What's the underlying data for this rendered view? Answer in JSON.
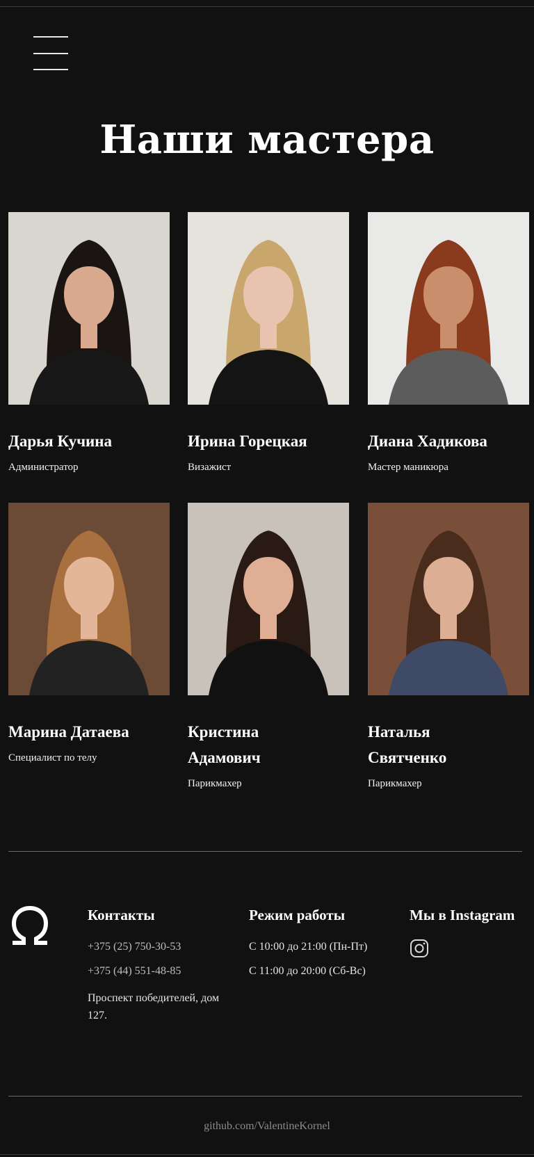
{
  "page": {
    "title": "Наши мастера"
  },
  "menu": {
    "icon": "hamburger-menu-icon"
  },
  "masters": [
    {
      "name": "Дарья Кучина",
      "role": "Администратор",
      "photo": {
        "bg": "#d9d6d0",
        "hair": "#1a1412",
        "top": "#181818",
        "skin": "#d9a98f"
      }
    },
    {
      "name": "Ирина Горецкая",
      "role": "Визажист",
      "photo": {
        "bg": "#e6e2dc",
        "hair": "#c9a66b",
        "top": "#141414",
        "skin": "#e8c4b0"
      }
    },
    {
      "name": "Диана Хадикова",
      "role": "Мастер маникюра",
      "photo": {
        "bg": "#e9e9e7",
        "hair": "#8a3b1e",
        "top": "#5c5c5c",
        "skin": "#c98f6c"
      }
    },
    {
      "name": "Марина Датаева",
      "role": "Специалист по телу",
      "photo": {
        "bg": "#6b4a36",
        "hair": "#a8703e",
        "top": "#222222",
        "skin": "#e3b69a"
      }
    },
    {
      "name": "Кристина Адамович",
      "role": "Парикмахер",
      "photo": {
        "bg": "#c9c2bb",
        "hair": "#2a1a14",
        "top": "#111111",
        "skin": "#e0ae95"
      }
    },
    {
      "name": "Наталья Святченко",
      "role": "Парикмахер",
      "photo": {
        "bg": "#7a4f3a",
        "hair": "#4a2c1c",
        "top": "#3e4a66",
        "skin": "#dcae93"
      }
    }
  ],
  "footer": {
    "logo": "omega-logo-icon",
    "contacts": {
      "heading": "Контакты",
      "phone1": "+375 (25) 750-30-53",
      "phone2": "+375 (44) 551-48-85",
      "address": "Проспект победителей, дом 127."
    },
    "hours": {
      "heading": "Режим работы",
      "weekdays": "С 10:00 до 21:00 (Пн-Пт)",
      "weekend": "С 11:00 до 20:00 (Сб-Вс)"
    },
    "social": {
      "heading": "Мы в Instagram",
      "icon": "instagram-icon"
    },
    "github": "github.com/ValentineKornel"
  },
  "colors": {
    "background": "#111111",
    "text": "#ffffff",
    "muted": "#8c8c8c"
  }
}
